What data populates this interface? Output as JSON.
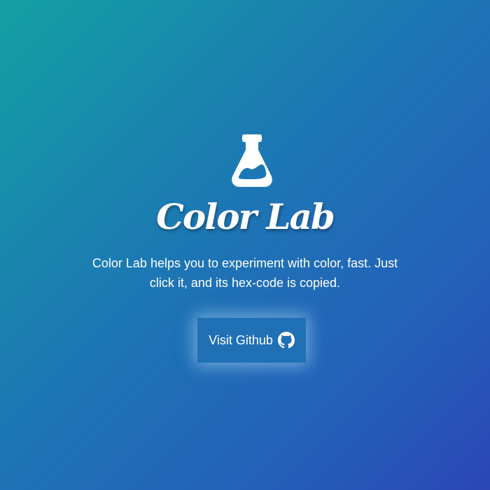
{
  "hero": {
    "icon": "flask-icon",
    "title": "Color Lab",
    "description": "Color Lab helps you to experiment with color, fast. Just click it, and its hex-code is copied.",
    "button": {
      "label": "Visit Github",
      "icon": "github-icon"
    }
  },
  "colors": {
    "gradient_start": "#13a0a3",
    "gradient_end": "#2b47b7",
    "button_bg": "#2070b6",
    "text": "#ffffff"
  }
}
